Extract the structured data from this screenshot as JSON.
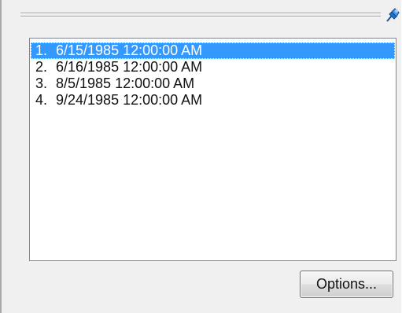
{
  "panel": {
    "pin_icon": "pushpin-icon"
  },
  "list": {
    "items": [
      {
        "number": "1.",
        "text": "6/15/1985 12:00:00 AM",
        "selected": true
      },
      {
        "number": "2.",
        "text": "6/16/1985 12:00:00 AM",
        "selected": false
      },
      {
        "number": "3.",
        "text": "8/5/1985 12:00:00 AM",
        "selected": false
      },
      {
        "number": "4.",
        "text": "9/24/1985 12:00:00 AM",
        "selected": false
      }
    ]
  },
  "buttons": {
    "options_label": "Options..."
  },
  "colors": {
    "selection": "#3399ff",
    "pin_blue": "#1f6fd0"
  }
}
